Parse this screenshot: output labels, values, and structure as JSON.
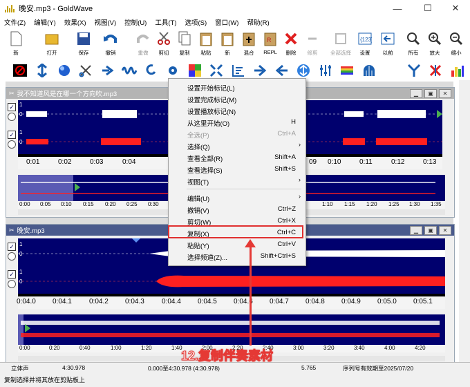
{
  "window": {
    "title": "晚安.mp3 - GoldWave",
    "min": "—",
    "max": "☐",
    "close": "✕"
  },
  "menu": [
    "文件(Z)",
    "编辑(Y)",
    "效果(X)",
    "视图(V)",
    "控制(U)",
    "工具(T)",
    "选项(S)",
    "窗口(W)",
    "帮助(R)"
  ],
  "toolbar": [
    {
      "label": "新",
      "icon": "new-file-icon",
      "disabled": false
    },
    {
      "label": "打开",
      "icon": "open-folder-icon",
      "disabled": false
    },
    {
      "label": "保存",
      "icon": "save-icon",
      "disabled": false
    },
    {
      "label": "撤销",
      "icon": "undo-icon",
      "disabled": false
    },
    {
      "label": "重做",
      "icon": "redo-icon",
      "disabled": true
    },
    {
      "label": "剪切",
      "icon": "cut-icon",
      "disabled": false
    },
    {
      "label": "复制",
      "icon": "copy-icon",
      "disabled": false
    },
    {
      "label": "粘贴",
      "icon": "paste-icon",
      "disabled": false
    },
    {
      "label": "新",
      "icon": "paste-new-icon",
      "disabled": false
    },
    {
      "label": "混合",
      "icon": "mix-icon",
      "disabled": false
    },
    {
      "label": "REPL",
      "icon": "replace-icon",
      "disabled": false
    },
    {
      "label": "删除",
      "icon": "delete-icon",
      "disabled": false
    },
    {
      "label": "修剪",
      "icon": "trim-icon",
      "disabled": true
    },
    {
      "label": "全部选择",
      "icon": "select-all-icon",
      "disabled": true
    },
    {
      "label": "设置",
      "icon": "set-marker-icon",
      "disabled": false
    },
    {
      "label": "以前",
      "icon": "previous-icon",
      "disabled": false
    },
    {
      "label": "所有",
      "icon": "zoom-all-icon",
      "disabled": false
    },
    {
      "label": "放大",
      "icon": "zoom-in-icon",
      "disabled": false
    },
    {
      "label": "缩小",
      "icon": "zoom-out-icon",
      "disabled": false
    }
  ],
  "effects_icons": [
    "stop-red-icon",
    "compress-arrows-icon",
    "sphere-icon",
    "cut-tool-icon",
    "echo-arrow-icon",
    "wave-icon",
    "loop-icon",
    "gear-icon",
    "colors-icon",
    "expand-icon",
    "spectrum-icon",
    "forward-arrow-icon",
    "back-arrow-icon",
    "updown-icon",
    "equalizer-icon",
    "rainbow-icon",
    "dome-icon",
    "fan-icon",
    "cross-icon",
    "bar-spectrum-icon"
  ],
  "track1": {
    "title": "我不知道风是在哪一个方向吹.mp3",
    "ch_l": "1",
    "ch_l0": "0",
    "ch_r": "1",
    "ch_r0": "0",
    "ruler": [
      "0:01",
      "0:02",
      "0:03",
      "0:04",
      "09",
      "0:10",
      "0:11",
      "0:12",
      "0:13"
    ],
    "overview_ruler": [
      "0:00",
      "0:05",
      "0:10",
      "0:15",
      "0:20",
      "0:25",
      "0:30",
      "1:10",
      "1:15",
      "1:20",
      "1:25",
      "1:30",
      "1:35"
    ]
  },
  "track2": {
    "title": "晚安.mp3",
    "ch_l": "1",
    "ch_l0": "0",
    "ch_r": "1",
    "ch_r0": "0",
    "ruler": [
      "0:04.0",
      "0:04.1",
      "0:04.2",
      "0:04.3",
      "0:04.4",
      "0:04.5",
      "0:04.6",
      "0:04.7",
      "0:04.8",
      "0:04.9",
      "0:05.0",
      "0:05.1"
    ],
    "overview_ruler": [
      "0:00",
      "0:20",
      "0:40",
      "1:00",
      "1:20",
      "1:40",
      "2:00",
      "2:20",
      "2:40",
      "3:00",
      "3:20",
      "3:40",
      "4:00",
      "4:20"
    ]
  },
  "context_menu": [
    {
      "label": "设置开始标记(L)",
      "shortcut": "",
      "sub": false,
      "disabled": false
    },
    {
      "label": "设置完成标记(M)",
      "shortcut": "",
      "sub": false,
      "disabled": false
    },
    {
      "label": "设置播放标记(N)",
      "shortcut": "",
      "sub": false,
      "disabled": false
    },
    {
      "label": "从这里开始(O)",
      "shortcut": "H",
      "sub": false,
      "disabled": false
    },
    {
      "label": "全选(P)",
      "shortcut": "Ctrl+A",
      "sub": false,
      "disabled": true
    },
    {
      "label": "选择(Q)",
      "shortcut": "",
      "sub": true,
      "disabled": false
    },
    {
      "label": "查看全部(R)",
      "shortcut": "Shift+A",
      "sub": false,
      "disabled": false
    },
    {
      "label": "查看选择(S)",
      "shortcut": "Shift+S",
      "sub": false,
      "disabled": false
    },
    {
      "label": "视图(T)",
      "shortcut": "",
      "sub": true,
      "disabled": false
    },
    {
      "label": "编辑(U)",
      "shortcut": "",
      "sub": true,
      "disabled": false
    },
    {
      "label": "撤销(V)",
      "shortcut": "Ctrl+Z",
      "sub": false,
      "disabled": false
    },
    {
      "label": "剪切(W)",
      "shortcut": "Ctrl+X",
      "sub": false,
      "disabled": false
    },
    {
      "label": "复制(X)",
      "shortcut": "Ctrl+C",
      "sub": false,
      "disabled": false
    },
    {
      "label": "粘贴(Y)",
      "shortcut": "Ctrl+V",
      "sub": false,
      "disabled": false
    },
    {
      "label": "选择频道(Z)...",
      "shortcut": "Shift+Ctrl+S",
      "sub": false,
      "disabled": false
    }
  ],
  "annotation": "12.复制伴奏素材",
  "status": {
    "channel": "立体声",
    "duration": "4:30.978",
    "range": "0.000至4:30.978 (4:30.978)",
    "value": "5.765",
    "license": "序列号有效期至2025/07/20",
    "hint": "复制选择并将其放在剪贴板上"
  },
  "colors": {
    "wave_bg": "#00006e",
    "left": "#ffffff",
    "right": "#ff2020",
    "accent": "#e53935"
  }
}
